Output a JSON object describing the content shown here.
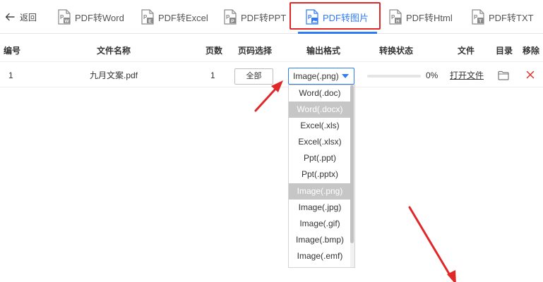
{
  "toolbar": {
    "back_label": "返回",
    "tabs": [
      {
        "label": "PDF转Word"
      },
      {
        "label": "PDF转Excel"
      },
      {
        "label": "PDF转PPT"
      },
      {
        "label": "PDF转图片"
      },
      {
        "label": "PDF转Html"
      },
      {
        "label": "PDF转TXT"
      }
    ],
    "active_tab": "PDF转图片"
  },
  "table": {
    "headers": {
      "index": "编号",
      "filename": "文件名称",
      "pages": "页数",
      "page_select": "页码选择",
      "output_format": "输出格式",
      "status": "转换状态",
      "file": "文件",
      "directory": "目录",
      "remove": "移除"
    },
    "rows": [
      {
        "index": "1",
        "filename": "九月文案.pdf",
        "pages": "1",
        "page_select": "全部",
        "output_format": "Image(.png)",
        "progress": 0,
        "progress_text": "0%",
        "file_action": "打开文件"
      }
    ]
  },
  "dropdown": {
    "options": [
      "Word(.doc)",
      "Word(.docx)",
      "Excel(.xls)",
      "Excel(.xlsx)",
      "Ppt(.ppt)",
      "Ppt(.pptx)",
      "Image(.png)",
      "Image(.jpg)",
      "Image(.gif)",
      "Image(.bmp)",
      "Image(.emf)"
    ],
    "highlighted": [
      "Word(.docx)",
      "Image(.png)"
    ]
  },
  "colors": {
    "accent": "#2f7cf6",
    "annotation_red": "#e02828",
    "selected_option": "#c6c6c6"
  }
}
